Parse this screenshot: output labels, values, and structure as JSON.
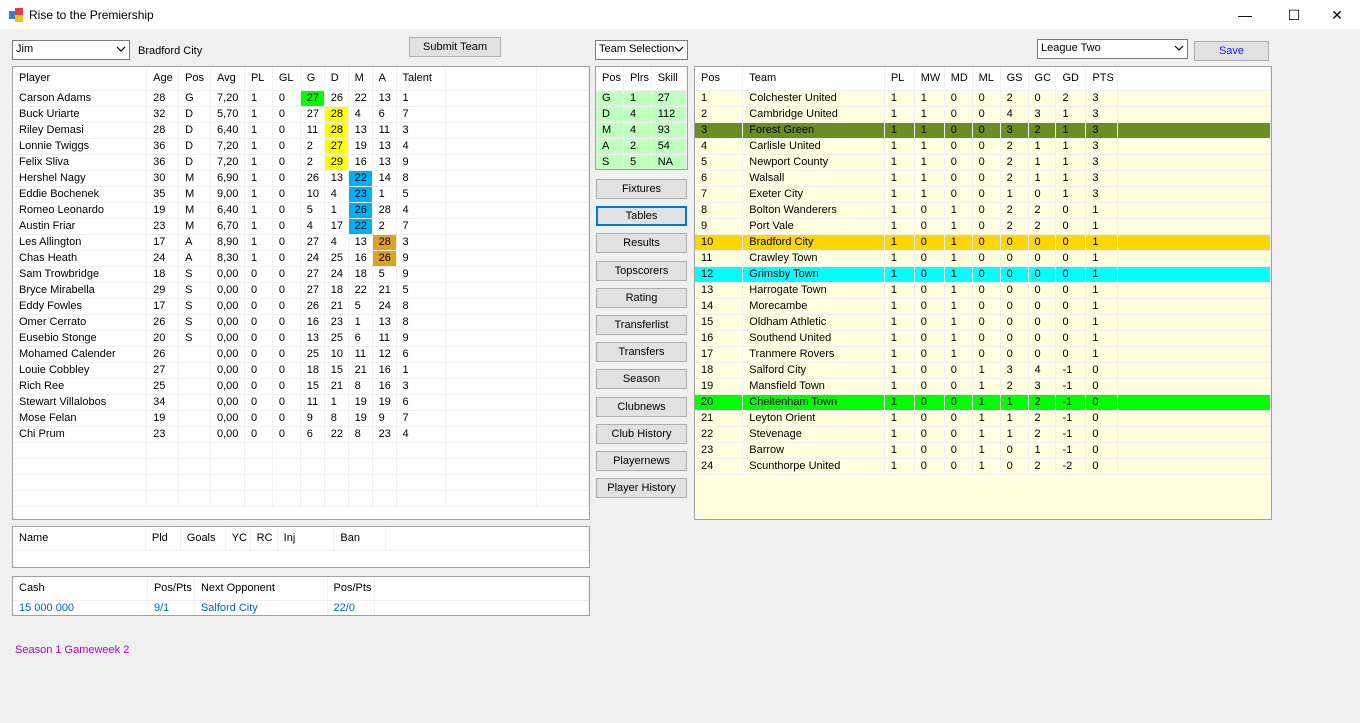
{
  "window": {
    "title": "Rise to the Premiership",
    "minimize": "—",
    "maximize": "☐",
    "close": "✕"
  },
  "manager": {
    "value": "Jim",
    "club": "Bradford City"
  },
  "submit_label": "Submit Team",
  "view_select": "Team Selection",
  "league_select": "League Two",
  "save_label": "Save",
  "players": {
    "headers": [
      "Player",
      "Age",
      "Pos",
      "Avg",
      "PL",
      "GL",
      "G",
      "D",
      "M",
      "A",
      "Talent"
    ],
    "rows": [
      [
        "Carson Adams",
        "28",
        "G",
        "7,20",
        "1",
        "0",
        "27",
        "26",
        "22",
        "13",
        "1"
      ],
      [
        "Buck Uriarte",
        "32",
        "D",
        "5,70",
        "1",
        "0",
        "27",
        "28",
        "4",
        "6",
        "7"
      ],
      [
        "Riley Demasi",
        "28",
        "D",
        "6,40",
        "1",
        "0",
        "11",
        "28",
        "13",
        "11",
        "3"
      ],
      [
        "Lonnie Twiggs",
        "36",
        "D",
        "7,20",
        "1",
        "0",
        "2",
        "27",
        "19",
        "13",
        "4"
      ],
      [
        "Felix Sliva",
        "36",
        "D",
        "7,20",
        "1",
        "0",
        "2",
        "29",
        "16",
        "13",
        "9"
      ],
      [
        "Hershel Nagy",
        "30",
        "M",
        "6,90",
        "1",
        "0",
        "26",
        "13",
        "22",
        "14",
        "8"
      ],
      [
        "Eddie Bochenek",
        "35",
        "M",
        "9,00",
        "1",
        "0",
        "10",
        "4",
        "23",
        "1",
        "5"
      ],
      [
        "Romeo Leonardo",
        "19",
        "M",
        "6,40",
        "1",
        "0",
        "5",
        "1",
        "26",
        "28",
        "4"
      ],
      [
        "Austin Friar",
        "23",
        "M",
        "6,70",
        "1",
        "0",
        "4",
        "17",
        "22",
        "2",
        "7"
      ],
      [
        "Les Allington",
        "17",
        "A",
        "8,90",
        "1",
        "0",
        "27",
        "4",
        "13",
        "28",
        "3"
      ],
      [
        "Chas Heath",
        "24",
        "A",
        "8,30",
        "1",
        "0",
        "24",
        "25",
        "16",
        "26",
        "9"
      ],
      [
        "Sam Trowbridge",
        "18",
        "S",
        "0,00",
        "0",
        "0",
        "27",
        "24",
        "18",
        "5",
        "9"
      ],
      [
        "Bryce Mirabella",
        "29",
        "S",
        "0,00",
        "0",
        "0",
        "27",
        "18",
        "22",
        "21",
        "5"
      ],
      [
        "Eddy Fowles",
        "17",
        "S",
        "0,00",
        "0",
        "0",
        "26",
        "21",
        "5",
        "24",
        "8"
      ],
      [
        "Omer Cerrato",
        "26",
        "S",
        "0,00",
        "0",
        "0",
        "16",
        "23",
        "1",
        "13",
        "8"
      ],
      [
        "Eusebio Stonge",
        "20",
        "S",
        "0,00",
        "0",
        "0",
        "13",
        "25",
        "6",
        "11",
        "9"
      ],
      [
        "Mohamed Calender",
        "26",
        "",
        "0,00",
        "0",
        "0",
        "25",
        "10",
        "11",
        "12",
        "6"
      ],
      [
        "Louie Cobbley",
        "27",
        "",
        "0,00",
        "0",
        "0",
        "18",
        "15",
        "21",
        "16",
        "1"
      ],
      [
        "Rich Ree",
        "25",
        "",
        "0,00",
        "0",
        "0",
        "15",
        "21",
        "8",
        "16",
        "3"
      ],
      [
        "Stewart Villalobos",
        "34",
        "",
        "0,00",
        "0",
        "0",
        "11",
        "1",
        "19",
        "19",
        "6"
      ],
      [
        "Mose Felan",
        "19",
        "",
        "0,00",
        "0",
        "0",
        "9",
        "8",
        "19",
        "9",
        "7"
      ],
      [
        "Chi Prum",
        "23",
        "",
        "0,00",
        "0",
        "0",
        "6",
        "22",
        "8",
        "23",
        "4"
      ]
    ]
  },
  "formation": {
    "headers": [
      "Pos",
      "Plrs",
      "Skill"
    ],
    "rows": [
      [
        "G",
        "1",
        "27"
      ],
      [
        "D",
        "4",
        "112"
      ],
      [
        "M",
        "4",
        "93"
      ],
      [
        "A",
        "2",
        "54"
      ],
      [
        "S",
        "5",
        "NA"
      ]
    ]
  },
  "menu": [
    "Fixtures",
    "Tables",
    "Results",
    "Topscorers",
    "Rating",
    "Transferlist",
    "Transfers",
    "Season",
    "Clubnews",
    "Club History",
    "Playernews",
    "Player History"
  ],
  "table": {
    "headers": [
      "Pos",
      "Team",
      "PL",
      "MW",
      "MD",
      "ML",
      "GS",
      "GC",
      "GD",
      "PTS"
    ],
    "rows": [
      [
        "1",
        "Colchester United",
        "1",
        "1",
        "0",
        "0",
        "2",
        "0",
        "2",
        "3"
      ],
      [
        "2",
        "Cambridge United",
        "1",
        "1",
        "0",
        "0",
        "4",
        "3",
        "1",
        "3"
      ],
      [
        "3",
        "Forest Green",
        "1",
        "1",
        "0",
        "0",
        "3",
        "2",
        "1",
        "3"
      ],
      [
        "4",
        "Carlisle United",
        "1",
        "1",
        "0",
        "0",
        "2",
        "1",
        "1",
        "3"
      ],
      [
        "5",
        "Newport County",
        "1",
        "1",
        "0",
        "0",
        "2",
        "1",
        "1",
        "3"
      ],
      [
        "6",
        "Walsall",
        "1",
        "1",
        "0",
        "0",
        "2",
        "1",
        "1",
        "3"
      ],
      [
        "7",
        "Exeter City",
        "1",
        "1",
        "0",
        "0",
        "1",
        "0",
        "1",
        "3"
      ],
      [
        "8",
        "Bolton Wanderers",
        "1",
        "0",
        "1",
        "0",
        "2",
        "2",
        "0",
        "1"
      ],
      [
        "9",
        "Port Vale",
        "1",
        "0",
        "1",
        "0",
        "2",
        "2",
        "0",
        "1"
      ],
      [
        "10",
        "Bradford City",
        "1",
        "0",
        "1",
        "0",
        "0",
        "0",
        "0",
        "1"
      ],
      [
        "11",
        "Crawley Town",
        "1",
        "0",
        "1",
        "0",
        "0",
        "0",
        "0",
        "1"
      ],
      [
        "12",
        "Grimsby Town",
        "1",
        "0",
        "1",
        "0",
        "0",
        "0",
        "0",
        "1"
      ],
      [
        "13",
        "Harrogate Town",
        "1",
        "0",
        "1",
        "0",
        "0",
        "0",
        "0",
        "1"
      ],
      [
        "14",
        "Morecambe",
        "1",
        "0",
        "1",
        "0",
        "0",
        "0",
        "0",
        "1"
      ],
      [
        "15",
        "Oldham Athletic",
        "1",
        "0",
        "1",
        "0",
        "0",
        "0",
        "0",
        "1"
      ],
      [
        "16",
        "Southend United",
        "1",
        "0",
        "1",
        "0",
        "0",
        "0",
        "0",
        "1"
      ],
      [
        "17",
        "Tranmere Rovers",
        "1",
        "0",
        "1",
        "0",
        "0",
        "0",
        "0",
        "1"
      ],
      [
        "18",
        "Salford City",
        "1",
        "0",
        "0",
        "1",
        "3",
        "4",
        "-1",
        "0"
      ],
      [
        "19",
        "Mansfield Town",
        "1",
        "0",
        "0",
        "1",
        "2",
        "3",
        "-1",
        "0"
      ],
      [
        "20",
        "Cheltenham Town",
        "1",
        "0",
        "0",
        "1",
        "1",
        "2",
        "-1",
        "0"
      ],
      [
        "21",
        "Leyton Orient",
        "1",
        "0",
        "0",
        "1",
        "1",
        "2",
        "-1",
        "0"
      ],
      [
        "22",
        "Stevenage",
        "1",
        "0",
        "0",
        "1",
        "1",
        "2",
        "-1",
        "0"
      ],
      [
        "23",
        "Barrow",
        "1",
        "0",
        "0",
        "1",
        "0",
        "1",
        "-1",
        "0"
      ],
      [
        "24",
        "Scunthorpe United",
        "1",
        "0",
        "0",
        "1",
        "0",
        "2",
        "-2",
        "0"
      ]
    ]
  },
  "player_detail": {
    "headers": [
      "Name",
      "Pld",
      "Goals",
      "YC",
      "RC",
      "Inj",
      "Ban"
    ]
  },
  "finance": {
    "headers": [
      "Cash",
      "Pos/Pts",
      "Next Opponent",
      "Pos/Pts"
    ],
    "values": [
      "15 000 000",
      "9/1",
      "Salford City",
      "22/0"
    ]
  },
  "status": "Season 1 Gameweek 2"
}
